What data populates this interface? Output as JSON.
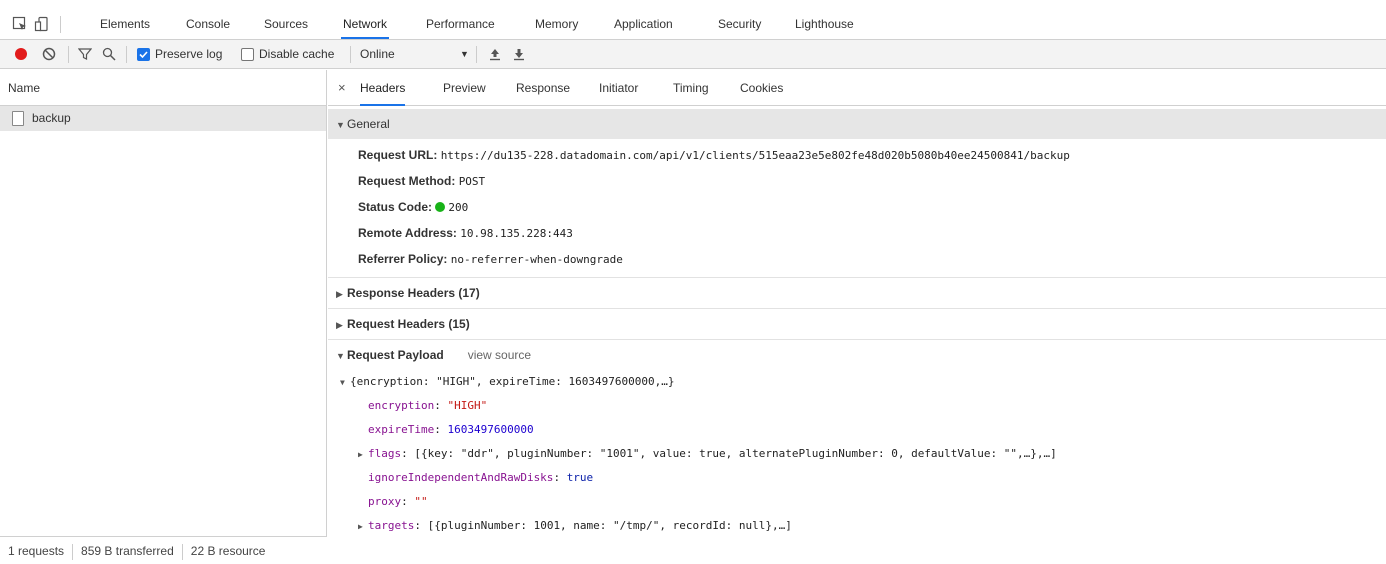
{
  "devtools": {
    "panel_tabs": [
      "Elements",
      "Console",
      "Sources",
      "Network",
      "Performance",
      "Memory",
      "Application",
      "Security",
      "Lighthouse"
    ],
    "active_panel": "Network"
  },
  "toolbar": {
    "preserve_log_label": "Preserve log",
    "preserve_log_checked": true,
    "disable_cache_label": "Disable cache",
    "disable_cache_checked": false,
    "throttle_value": "Online",
    "record_color": "#e21b1b"
  },
  "request_list": {
    "header": "Name",
    "items": [
      {
        "name": "backup"
      }
    ],
    "status": {
      "requests": "1 requests",
      "transferred": "859 B transferred",
      "resources": "22 B resource"
    }
  },
  "detail": {
    "close_glyph": "×",
    "tabs": [
      "Headers",
      "Preview",
      "Response",
      "Initiator",
      "Timing",
      "Cookies"
    ],
    "active_tab": "Headers",
    "general": {
      "title": "General",
      "rows": [
        {
          "key": "Request URL:",
          "value": "https://du135-228.datadomain.com/api/v1/clients/515eaa23e5e802fe48d020b5080b40ee24500841/backup"
        },
        {
          "key": "Request Method:",
          "value": "POST"
        },
        {
          "key": "Status Code:",
          "value": "200"
        },
        {
          "key": "Remote Address:",
          "value": "10.98.135.228:443"
        },
        {
          "key": "Referrer Policy:",
          "value": "no-referrer-when-downgrade"
        }
      ]
    },
    "response_headers": "Response Headers (17)",
    "request_headers": "Request Headers (15)",
    "payload": {
      "title": "Request Payload",
      "view_source": "view source",
      "summary": "{encryption: \"HIGH\", expireTime: 1603497600000,…}",
      "encryption_key": "encryption",
      "encryption_value": "\"HIGH\"",
      "expire_key": "expireTime",
      "expire_value": "1603497600000",
      "flags_key": "flags",
      "flags_value": "[{key: \"ddr\", pluginNumber: \"1001\", value: true, alternatePluginNumber: 0, defaultValue: \"\",…},…]",
      "ignore_key": "ignoreIndependentAndRawDisks",
      "ignore_value": "true",
      "proxy_key": "proxy",
      "proxy_value": "\"\"",
      "targets_key": "targets",
      "targets_value": "[{pluginNumber: 1001, name: \"/tmp/\", recordId: null},…]"
    }
  }
}
